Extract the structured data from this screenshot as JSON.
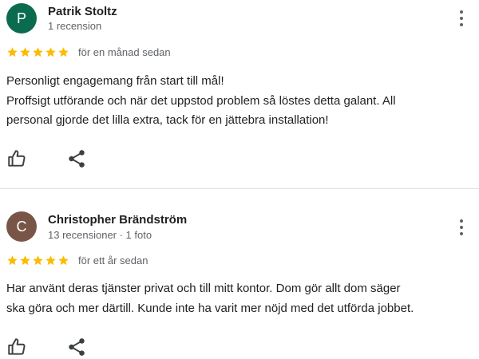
{
  "reviews": [
    {
      "avatar_letter": "P",
      "avatar_color": "#0b6b4f",
      "author": "Patrik Stoltz",
      "meta": "1 recension",
      "rating": 5,
      "time": "för en månad sedan",
      "text_lines": [
        "Personligt engagemang från start till mål!",
        "Proffsigt utförande och när det uppstod problem så löstes detta galant. All",
        "personal gjorde det lilla extra, tack för en jättebra installation!"
      ]
    },
    {
      "avatar_letter": "C",
      "avatar_color": "#795548",
      "author": "Christopher Brändström",
      "meta": "13 recensioner · 1 foto",
      "rating": 5,
      "time": "för ett år sedan",
      "text_lines": [
        "Har använt deras tjänster privat och till mitt kontor. Dom gör allt dom säger",
        "ska göra och mer därtill. Kunde inte ha varit mer nöjd med det utförda jobbet."
      ]
    }
  ],
  "colors": {
    "star": "#fbbc04",
    "icon": "#3c4043",
    "divider": "#e0e0e0"
  },
  "icons": [
    "thumb-up-icon",
    "share-icon",
    "more-vert-icon",
    "star-icon"
  ]
}
